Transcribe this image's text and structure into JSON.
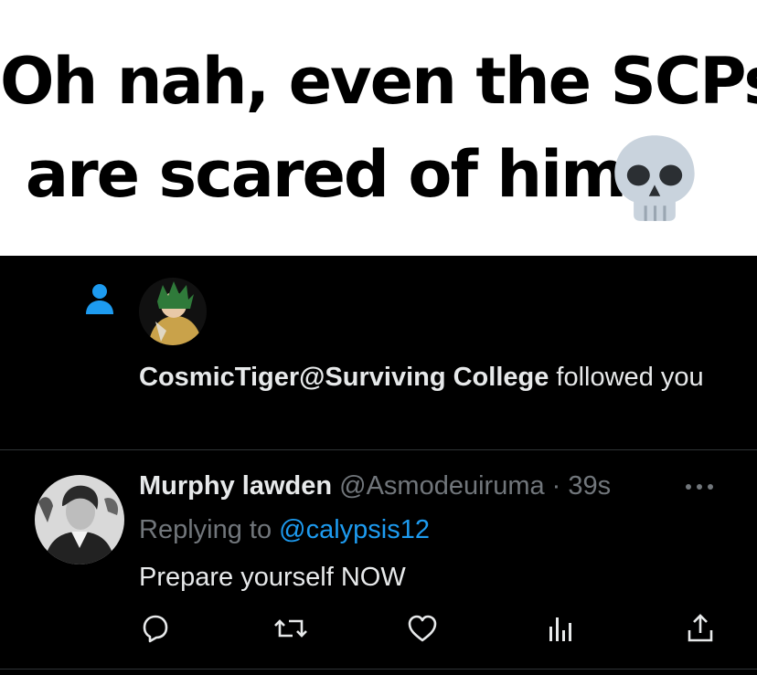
{
  "caption": {
    "line1": "Oh nah, even the SCPs",
    "line2": "are scared of him",
    "emoji": "skull-emoji"
  },
  "notification": {
    "icon": "person-icon",
    "display_name": "CosmicTiger@Surviving College",
    "action_text": " followed you"
  },
  "tweet": {
    "display_name": "Murphy lawden",
    "handle": "@Asmodeuiruma",
    "separator": "·",
    "time": "39s",
    "replying_prefix": "Replying to ",
    "replying_handle": "@calypsis12",
    "text": "Prepare yourself NOW",
    "actions": [
      "reply-icon",
      "retweet-icon",
      "like-icon",
      "views-icon",
      "share-icon"
    ]
  },
  "colors": {
    "background": "#000000",
    "text": "#e7e9ea",
    "muted": "#71767b",
    "accent": "#1d9bf0"
  }
}
